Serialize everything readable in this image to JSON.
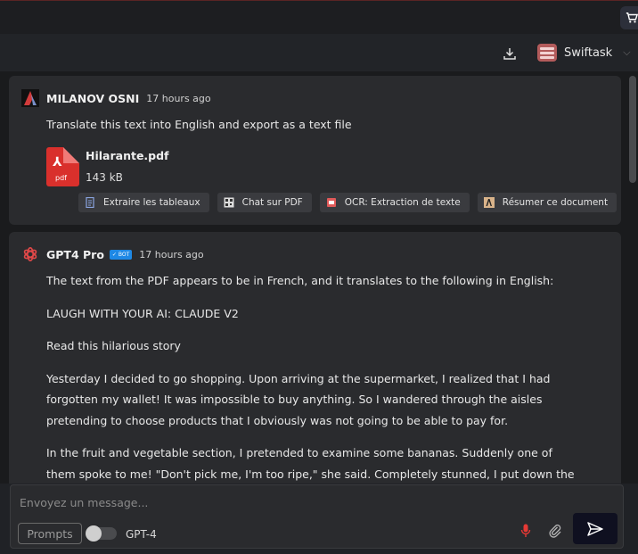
{
  "header": {
    "workspace_name": "Swiftask"
  },
  "messages": [
    {
      "author": "MILANOV OSNI",
      "time": "17 hours ago",
      "text": "Translate this text into English and export as a text file",
      "attachment": {
        "name": "Hilarante.pdf",
        "size": "143 kB",
        "icon_label": "pdf"
      },
      "actions": [
        "Extraire les tableaux",
        "Chat sur PDF",
        "OCR: Extraction de texte",
        "Résumer ce document"
      ]
    },
    {
      "author": "GPT4 Pro",
      "badge": "BOT",
      "time": "17 hours ago",
      "paragraphs": [
        "The text from the PDF appears to be in French, and it translates to the following in English:",
        "LAUGH WITH YOUR AI: CLAUDE V2",
        "Read this hilarious story",
        "Yesterday I decided to go shopping. Upon arriving at the supermarket, I realized that I had forgotten my wallet! It was impossible to buy anything. So I wandered through the aisles pretending to choose products that I obviously was not going to be able to pay for.",
        "In the fruit and vegetable section, I pretended to examine some bananas. Suddenly one of them spoke to me! \"Don't pick me, I'm too ripe,\" she said. Completely stunned, I put down the banana and"
      ]
    }
  ],
  "composer": {
    "placeholder": "Envoyez un message...",
    "prompts_label": "Prompts",
    "model_label": "GPT-4"
  },
  "colors": {
    "accent_mic": "#e53935",
    "pdf_red": "#d9302c",
    "bot_badge": "#1e88e5",
    "brand": "#b35b5b"
  }
}
